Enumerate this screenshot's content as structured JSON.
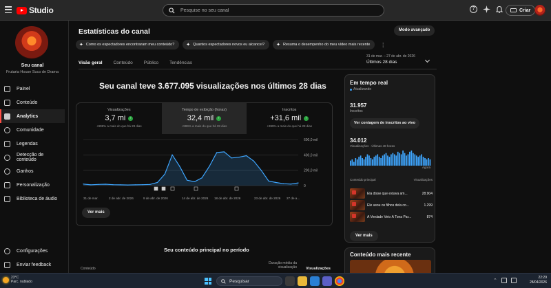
{
  "topbar": {
    "logo_text": "Studio",
    "search_placeholder": "Pesquise no seu canal",
    "help_icon_text": "?",
    "create_label": "Criar"
  },
  "sidebar": {
    "channel_title": "Seu canal",
    "channel_subtitle": "Frutaria House Suco de Drama",
    "items": [
      {
        "label": "Painel",
        "icon": "dashboard-icon"
      },
      {
        "label": "Conteúdo",
        "icon": "content-icon"
      },
      {
        "label": "Analytics",
        "icon": "analytics-icon",
        "active": true
      },
      {
        "label": "Comunidade",
        "icon": "community-icon"
      },
      {
        "label": "Legendas",
        "icon": "subtitles-icon"
      },
      {
        "label": "Detecção de conteúdo",
        "icon": "content-detection-icon"
      },
      {
        "label": "Ganhos",
        "icon": "earnings-icon"
      },
      {
        "label": "Personalização",
        "icon": "customization-icon"
      },
      {
        "label": "Biblioteca de áudio",
        "icon": "audio-library-icon"
      }
    ],
    "bottom_items": [
      {
        "label": "Configurações",
        "icon": "settings-icon"
      },
      {
        "label": "Enviar feedback",
        "icon": "feedback-icon"
      }
    ]
  },
  "main": {
    "title": "Estatísticas do canal",
    "advanced_mode": "Modo avançado",
    "chips": [
      "Como os espectadores encontraram meu conteúdo?",
      "Quantos espectadores novos eu alcancei?",
      "Resuma o desempenho do meu vídeo mais recente"
    ],
    "kebab": "⋮",
    "tabs": [
      "Visão geral",
      "Conteúdo",
      "Público",
      "Tendências"
    ],
    "date_range_small": "31 de mar. – 27 de abr. de 2026",
    "date_range": "Últimos 28 dias",
    "headline": "Seu canal teve 3.677.095 visualizações nos últimos 28 dias",
    "metrics": [
      {
        "label": "Visualizações",
        "value": "3,7 mi",
        "sub": "+999% a mais do que há 28 dias"
      },
      {
        "label": "Tempo de exibição (horas)",
        "value": "32,4 mil",
        "sub": "+999% a mais do que há 28 dias"
      },
      {
        "label": "Inscritos",
        "value": "+31,6 mil",
        "sub": "+999% a mais do que há 28 dias"
      }
    ],
    "see_more": "Ver mais",
    "top_content_title": "Seu conteúdo principal no período",
    "table_headers": {
      "content": "Conteúdo",
      "avg_duration": "Duração média da visualização",
      "views": "Visualizações"
    }
  },
  "chart_data": {
    "type": "line",
    "x_tick_labels": [
      "31 de mar.",
      "2 de abr. de 2026",
      "9 de abr. de 2026",
      "14 de abr. de 2026",
      "18 de abr. de 2026",
      "23 de abr. de 2026",
      "27 de a..."
    ],
    "y_tick_labels": [
      "600,0 mil",
      "400,0 mil",
      "200,0 mil",
      "0"
    ],
    "ylim": [
      0,
      600000
    ],
    "series": [
      {
        "values": [
          20000,
          10000,
          15000,
          18000,
          12000,
          10000,
          8000,
          10000,
          12000,
          15000,
          40000,
          150000,
          400000,
          250000,
          70000,
          50000,
          100000,
          250000,
          430000,
          440000,
          360000,
          370000,
          390000,
          320000,
          200000,
          60000,
          40000,
          25000,
          20000,
          35000
        ]
      }
    ],
    "marker_icons": 5,
    "color": "#3ea6ff"
  },
  "realtime": {
    "title": "Em tempo real",
    "status": "Atualizando",
    "subscribers": "31.957",
    "subscribers_label": "Inscritos",
    "live_count_button": "Ver contagem de inscritos ao vivo",
    "views": "34.012",
    "views_label": "Visualizações · Últimas 48 horas",
    "now_label": "Agora",
    "list_headers": {
      "content": "Conteúdo principal",
      "views": "Visualizações"
    },
    "bars": [
      4,
      5,
      3,
      6,
      5,
      7,
      8,
      6,
      5,
      7,
      9,
      8,
      6,
      5,
      7,
      8,
      9,
      7,
      6,
      8,
      9,
      10,
      8,
      7,
      9,
      10,
      9,
      8,
      11,
      10,
      9,
      12,
      10,
      8,
      9,
      11,
      12,
      10,
      9,
      8,
      7,
      8,
      9,
      7,
      6,
      5,
      6,
      5
    ],
    "rows": [
      {
        "title": "Ela disse que estava am...",
        "views": "28.904"
      },
      {
        "title": "Ele usou os filhos dela co...",
        "views": "1.299"
      },
      {
        "title": "A Verdade Veio À Tona Par...",
        "views": "874"
      }
    ],
    "see_more": "Ver mais"
  },
  "recent": {
    "title": "Conteúdo mais recente"
  },
  "taskbar": {
    "temperature": "23°C",
    "weather": "Parc. nublado",
    "search_label": "Pesquisar",
    "time": "22:29",
    "date": "28/04/2026"
  }
}
